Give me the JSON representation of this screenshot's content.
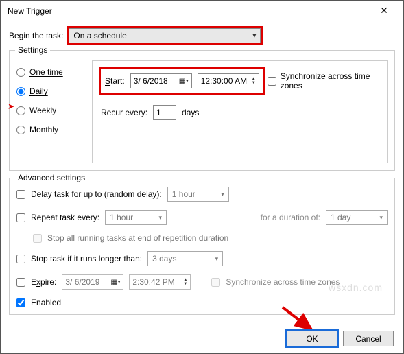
{
  "window": {
    "title": "New Trigger",
    "close": "✕"
  },
  "begin": {
    "label": "Begin the task:",
    "value": "On a schedule"
  },
  "settings": {
    "legend": "Settings",
    "radios": {
      "one_time": "One time",
      "daily": "Daily",
      "weekly": "Weekly",
      "monthly": "Monthly"
    },
    "start_label": "Start:",
    "start_date": "3/ 6/2018",
    "start_time": "12:30:00 AM",
    "sync_label": "Synchronize across time zones",
    "recur_label": "Recur every:",
    "recur_value": "1",
    "recur_unit": "days"
  },
  "advanced": {
    "legend": "Advanced settings",
    "delay_label": "Delay task for up to (random delay):",
    "delay_value": "1 hour",
    "repeat_label": "Repeat task every:",
    "repeat_value": "1 hour",
    "duration_label": "for a duration of:",
    "duration_value": "1 day",
    "stop_all_label": "Stop all running tasks at end of repetition duration",
    "stop_if_label": "Stop task if it runs longer than:",
    "stop_if_value": "3 days",
    "expire_label": "Expire:",
    "expire_date": "3/ 6/2019",
    "expire_time": "2:30:42 PM",
    "expire_sync": "Synchronize across time zones",
    "enabled_label": "Enabled"
  },
  "footer": {
    "ok": "OK",
    "cancel": "Cancel"
  },
  "watermark": "wsxdn.com"
}
